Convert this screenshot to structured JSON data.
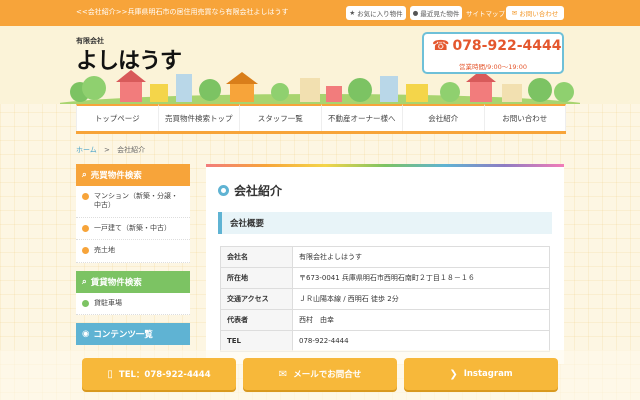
{
  "topbar": {
    "tagline": "<<会社紹介>>兵庫県明石市の居住用売買なら有限会社よしはうす",
    "favorites": "お気に入り物件",
    "recent": "最近見た物件",
    "sitemap": "サイトマップ",
    "inquiry": "お問い合わせ"
  },
  "logo": {
    "small": "有限会社",
    "big": "よしはうす"
  },
  "phone": {
    "number": "078-922-4444",
    "hours": "営業時間/9:00～19:00"
  },
  "nav": [
    {
      "label": "トップページ"
    },
    {
      "label": "売買物件検索トップ"
    },
    {
      "label": "スタッフ一覧"
    },
    {
      "label": "不動産オーナー様へ"
    },
    {
      "label": "会社紹介"
    },
    {
      "label": "お問い合わせ"
    }
  ],
  "breadcrumb": {
    "home": "ホーム",
    "sep": ">",
    "current": "会社紹介"
  },
  "sidebar": {
    "sale": {
      "title": "売買物件検索",
      "items": [
        {
          "label": "マンション（新築・分譲・中古）"
        },
        {
          "label": "一戸建て（新築・中古）"
        },
        {
          "label": "売土地"
        }
      ]
    },
    "rent": {
      "title": "賃貸物件検索",
      "items": [
        {
          "label": "貸駐車場"
        }
      ]
    },
    "contents": {
      "title": "コンテンツ一覧"
    }
  },
  "main": {
    "title": "会社紹介",
    "section": "会社概要",
    "rows": [
      {
        "key": "会社名",
        "value": "有限会社よしはうす"
      },
      {
        "key": "所在地",
        "value": "〒673-0041 兵庫県明石市西明石南町２丁目１８－１６"
      },
      {
        "key": "交通アクセス",
        "value": "ＪＲ山陽本線 / 西明石 徒歩 2分"
      },
      {
        "key": "代表者",
        "value": "西村　由幸"
      },
      {
        "key": "TEL",
        "value": "078-922-4444"
      }
    ]
  },
  "actions": {
    "tel": "TEL：078-922-4444",
    "mail": "メールでお問合せ",
    "instagram": "Instagram"
  },
  "colors": {
    "accent": "#f7a43a",
    "green": "#7cc363",
    "blue": "#5fb3d3",
    "phone": "#e4572e"
  }
}
